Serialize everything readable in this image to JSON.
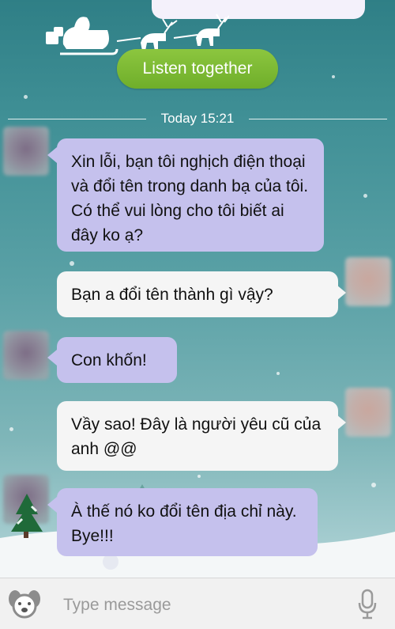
{
  "header": {
    "listen_button": "Listen together"
  },
  "timestamp": "Today 15:21",
  "messages": [
    {
      "side": "in",
      "text": "Xin lỗi, bạn tôi nghịch điện thoại và đổi tên trong danh bạ của tôi. Có thể vui lòng cho tôi biết ai đây ko ạ?"
    },
    {
      "side": "out",
      "text": "Bạn a đổi tên thành gì vậy?"
    },
    {
      "side": "in",
      "text": "Con khốn!"
    },
    {
      "side": "out",
      "text": "Vầy sao! Đây là người yêu cũ của anh @@"
    },
    {
      "side": "in",
      "text": "À thế nó ko đổi tên địa chỉ này. Bye!!!"
    }
  ],
  "input_bar": {
    "placeholder": "Type message",
    "left_icon": "dog-face-icon",
    "right_icon": "microphone-icon"
  },
  "colors": {
    "incoming_bubble": "#c5c1ed",
    "outgoing_bubble": "#f5f5f5",
    "listen_button": "#7cba33"
  }
}
